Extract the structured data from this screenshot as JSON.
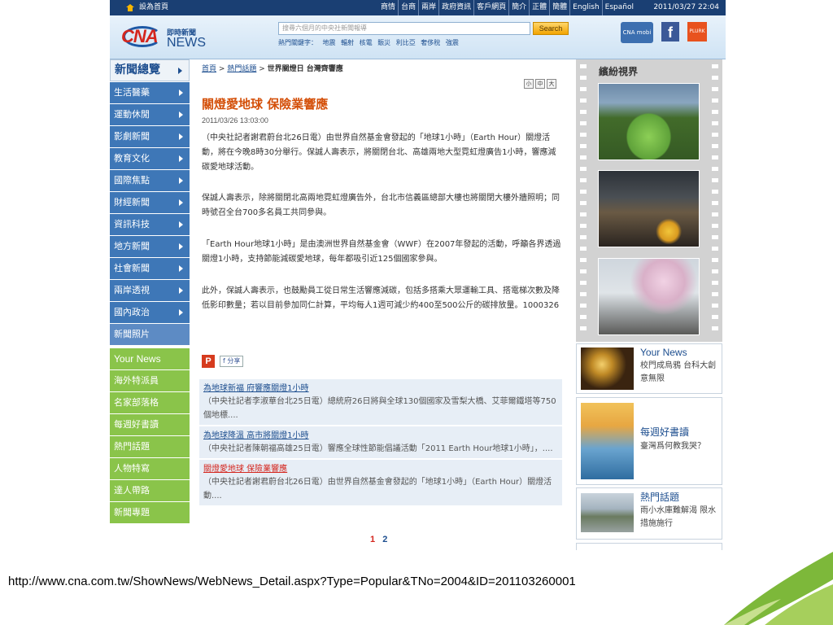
{
  "topbar": {
    "home_label": "設為首頁",
    "links": [
      "商情",
      "台商",
      "兩岸",
      "政府資訊",
      "客戶網頁",
      "簡介",
      "正體",
      "簡體",
      "English",
      "Español"
    ],
    "datetime": "2011/03/27 22:04"
  },
  "header": {
    "logo_cna": "CNA",
    "logo_sub": "即時新聞",
    "logo_news": "NEWS",
    "search_placeholder": "搜尋六個月的中央社新聞報導",
    "search_button": "Search",
    "hot_label": "熱門關鍵字：",
    "hot_keywords": [
      "地震",
      "輻射",
      "核電",
      "賑災",
      "利比亞",
      "奢侈稅",
      "強震"
    ],
    "icon_mobi": "CNA mobi",
    "icon_fb": "f",
    "icon_plurk": "PLURK"
  },
  "leftnav": {
    "head": "新聞總覽",
    "items": [
      "生活醫藥",
      "運動休閒",
      "影劇新聞",
      "教育文化",
      "國際焦點",
      "財經新聞",
      "資訊科技",
      "地方新聞",
      "社會新聞",
      "兩岸透視",
      "國內政治"
    ],
    "photo": "新聞照片",
    "green": [
      "Your News",
      "海外特派員",
      "名家部落格",
      "每週好書讀",
      "熱門話題",
      "人物特寫",
      "達人帶路",
      "新聞專題"
    ]
  },
  "article": {
    "breadcrumb_home": "首頁",
    "breadcrumb_sep1": ">",
    "breadcrumb_topic": "熱門話題",
    "breadcrumb_sep2": ">",
    "breadcrumb_current": "世界關燈日 台灣齊響應",
    "tools": [
      "小",
      "中",
      "大"
    ],
    "title": "關燈愛地球 保險業響應",
    "date": "2011/03/26 13:03:00",
    "paragraphs": [
      "（中央社記者謝君蔚台北26日電）由世界自然基金會發起的「地球1小時」（Earth Hour）關燈活動，將在今晚8時30分舉行。保誠人壽表示，將關閉台北、高雄兩地大型霓虹燈廣告1小時，響應減碳愛地球活動。",
      "保誠人壽表示，除將關閉北高兩地霓虹燈廣告外，台北市信義區總部大樓也將關閉大樓外牆照明；同時號召全台700多名員工共同參與。",
      "「Earth Hour地球1小時」是由澳洲世界自然基金會（WWF）在2007年發起的活動，呼籲各界透過關燈1小時，支持節能減碳愛地球，每年都吸引近125個國家參與。",
      "此外，保誠人壽表示，也鼓勵員工從日常生活響應減碳，包括多搭乘大眾運輸工具、搭電梯次數及降低影印數量；若以目前參加同仁計算，平均每人1週可減少約400至500公斤的碳排放量。1000326"
    ],
    "share_p": "P",
    "share_f": "f 分享"
  },
  "related": [
    {
      "title": "為地球新福 府響應關燈1小時",
      "summary": "（中央社記者李淑華台北25日電）總統府26日將與全球130個國家及雪梨大橋、艾菲爾鐵塔等750個地標....",
      "current": false
    },
    {
      "title": "為地球降溫 高市將關燈1小時",
      "summary": "（中央社記者陳朝福高雄25日電）響應全球性節能倡議活動「2011 Earth Hour地球1小時」，....",
      "current": false
    },
    {
      "title": "關燈愛地球 保險業響應",
      "summary": "（中央社記者謝君蔚台北26日電）由世界自然基金會發起的「地球1小時」（Earth Hour）關燈活動....",
      "current": true
    }
  ],
  "pager": {
    "current": "1",
    "next": "2"
  },
  "right": {
    "film_title": "繽紛視界",
    "cards": [
      {
        "title": "Your News",
        "summary": "校門成烏鴉 台科大創意無限"
      },
      {
        "title": "每週好書讀",
        "summary": "臺灣爲何教我哭？"
      },
      {
        "title": "熱門話題",
        "summary": "雨小水庫難解渴 限水措施施行"
      }
    ]
  },
  "url": "http://www.cna.com.tw/ShowNews/WebNews_Detail.aspx?Type=Popular&TNo=2004&ID=201103260001",
  "colors": {
    "topbar": "#1a3f73",
    "nav_blue": "#3e77b7",
    "nav_green": "#8ac44a",
    "title_orange": "#d4500a",
    "link_blue": "#1d4e8f"
  }
}
